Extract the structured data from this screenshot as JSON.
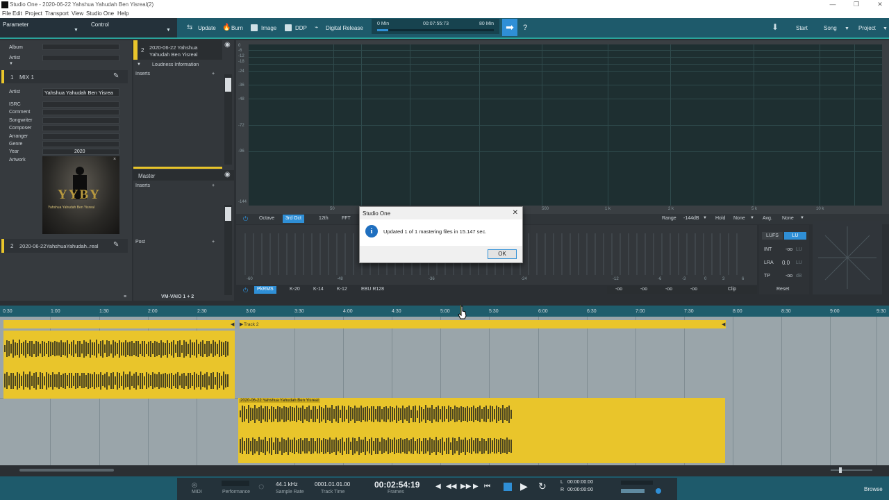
{
  "window": {
    "title": "Studio One - 2020-06-22 Yahshua Yahudah Ben Yisreal(2)",
    "controls": [
      "—",
      "❐",
      "✕"
    ]
  },
  "menu": [
    "File",
    "Edit",
    "Project",
    "Transport",
    "View",
    "Studio One",
    "Help"
  ],
  "toolbar": {
    "parameter_label": "Parameter",
    "control_label": "Control",
    "buttons": [
      "Update",
      "Burn",
      "Image",
      "DDP",
      "Digital Release"
    ],
    "time_start": "0 Min",
    "time_current": "00:07:55:73",
    "time_end": "80 Min",
    "help": "?",
    "nav": [
      "Start",
      "Song",
      "Project"
    ]
  },
  "metadata_panel": {
    "album_label": "Album",
    "artist_label": "Artist",
    "album_value": "",
    "artist_value": ""
  },
  "track1": {
    "number": "1",
    "name": "MIX 1",
    "fields": [
      {
        "label": "Artist",
        "value": "Yahshua Yahudah Ben Yisrea"
      },
      {
        "label": "ISRC",
        "value": ""
      },
      {
        "label": "Comment",
        "value": ""
      },
      {
        "label": "Songwriter",
        "value": ""
      },
      {
        "label": "Composer",
        "value": ""
      },
      {
        "label": "Arranger",
        "value": ""
      },
      {
        "label": "Genre",
        "value": ""
      },
      {
        "label": "Year",
        "value": "2020"
      },
      {
        "label": "Artwork",
        "value": ""
      }
    ],
    "artwork_text_big": "YYBY",
    "artwork_text_small": "Yahshua Yahudah Ben Yisreal"
  },
  "track2": {
    "number": "2",
    "name": "2020-06-22YahshuaYahudah..real"
  },
  "inserts_panel": {
    "track_number": "2",
    "track_title_line1": "2020-06-22 Yahshua",
    "track_title_line2": "Yahudah Ben Yisreal",
    "loudness_label": "Loudness Information",
    "inserts_label": "Inserts",
    "master_label": "Master",
    "master_inserts_label": "Inserts",
    "post_label": "Post",
    "output_label": "VM-VAIO 1 + 2"
  },
  "spectrum": {
    "db_ticks": [
      "0",
      "-6",
      "-12",
      "-18",
      "-24",
      "-36",
      "-48",
      "-72",
      "-96",
      "-144"
    ],
    "freq_ticks": [
      "50",
      "100",
      "200",
      "500",
      "1 k",
      "2 k",
      "5 k",
      "10 k"
    ],
    "octave_buttons": [
      {
        "label": "Octave",
        "selected": false
      },
      {
        "label": "3rd Oct",
        "selected": true
      },
      {
        "label": "12th",
        "selected": false
      },
      {
        "label": "FFT",
        "selected": false
      }
    ],
    "range_label": "Range",
    "range_value": "-144dB",
    "hold_label": "Hold",
    "hold_value": "None",
    "avg_label": "Avg.",
    "avg_value": "None"
  },
  "meter": {
    "scale_ticks": [
      "-60",
      "-48",
      "-36",
      "-24",
      "-12",
      "-6",
      "-3",
      "0",
      "3",
      "6"
    ],
    "buttons": [
      {
        "label": "PkRMS",
        "selected": true
      },
      {
        "label": "K-20",
        "selected": false
      },
      {
        "label": "K-14",
        "selected": false
      },
      {
        "label": "K-12",
        "selected": false
      },
      {
        "label": "EBU R128",
        "selected": false
      }
    ],
    "clip_label": "Clip",
    "readouts": [
      "-oo",
      "-oo",
      "-oo",
      "-oo"
    ]
  },
  "loudness": {
    "lufs_label": "LUFS",
    "lu_label": "LU",
    "int_label": "INT",
    "int_value": "-oo",
    "int_unit": "LU",
    "lra_label": "LRA",
    "lra_value": "0.0",
    "lra_unit": "LU",
    "tp_label": "TP",
    "tp_value": "-oo",
    "tp_unit": "dB",
    "reset_label": "Reset"
  },
  "ruler": {
    "marks": [
      "0:30",
      "1:00",
      "1:30",
      "2:00",
      "2:30",
      "3:00",
      "3:30",
      "4:00",
      "4:30",
      "5:00",
      "5:30",
      "6:00",
      "6:30",
      "7:00",
      "7:30",
      "8:00",
      "8:30",
      "9:00",
      "9:30"
    ]
  },
  "timeline": {
    "track2_marker": "Track 2",
    "clip2_name": "2020-06-22 Yahshua Yahudah Ben Yisreal"
  },
  "transport": {
    "midi_label": "MIDI",
    "performance_label": "Performance",
    "sample_rate_value": "44.1 kHz",
    "sample_rate_label": "Sample Rate",
    "track_time_value": "0001.01.01.00",
    "track_time_label": "Track Time",
    "frames_value": "00:02:54:19",
    "frames_label": "Frames",
    "l_label": "L",
    "l_value": "00:00:00:00",
    "r_label": "R",
    "r_value": "00:00:00:00",
    "browse_label": "Browse"
  },
  "dialog": {
    "title": "Studio One",
    "message": "Updated 1 of 1 mastering files in 15.147 sec.",
    "ok_label": "OK"
  },
  "colors": {
    "accent": "#2f8fd6",
    "toolbar": "#1e5a6b",
    "clip_yellow": "#e9c52b",
    "waveform": "#4a4420",
    "track_area": "#9aa5aa"
  }
}
